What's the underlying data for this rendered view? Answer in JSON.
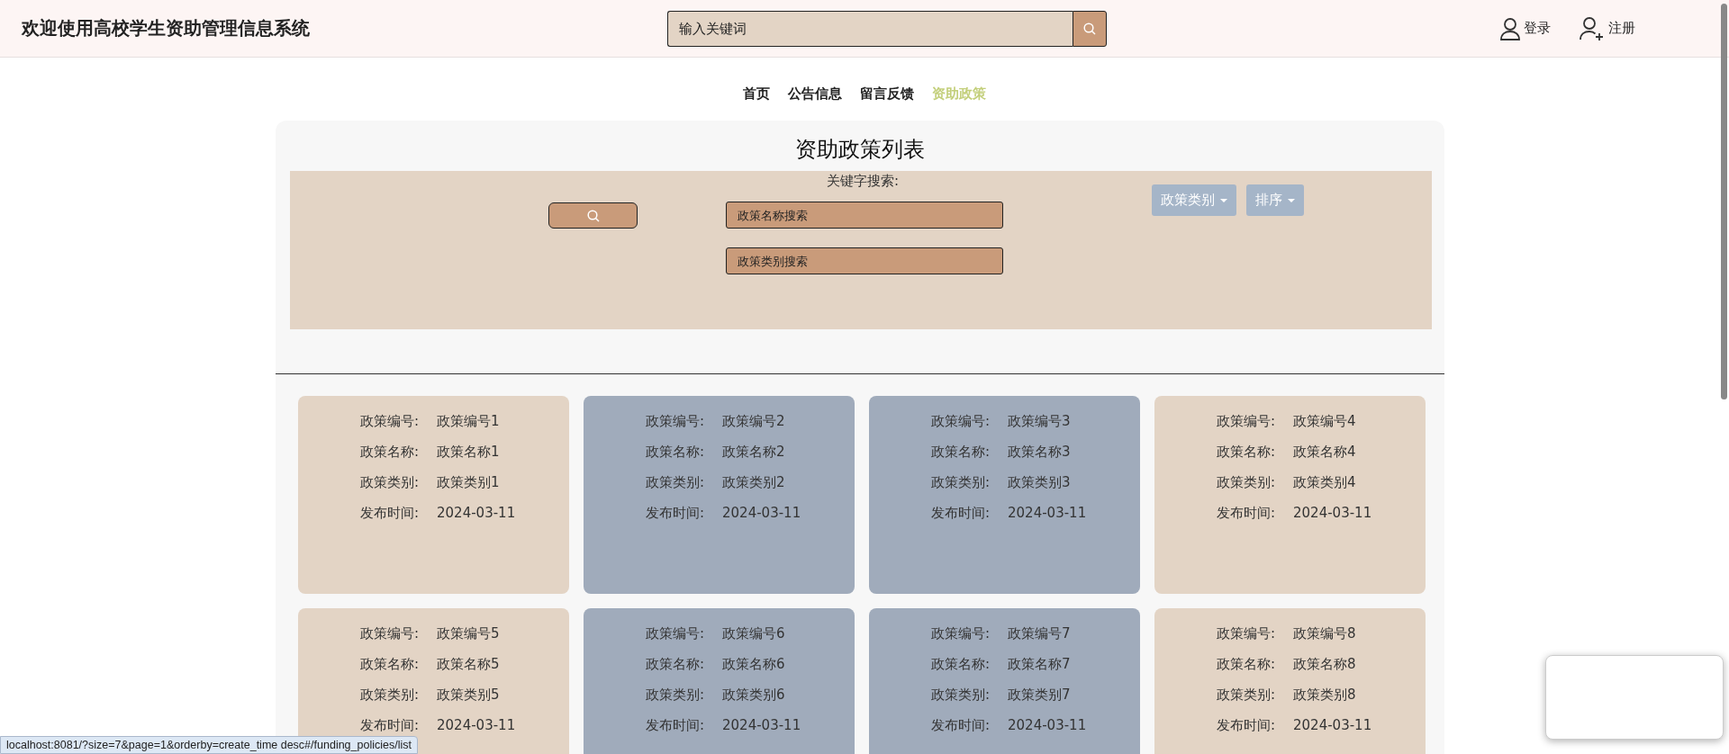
{
  "header": {
    "title": "欢迎使用高校学生资助管理信息系统",
    "search": {
      "placeholder": "输入关键词"
    },
    "links": [
      {
        "kind": "login",
        "label": "登录"
      },
      {
        "kind": "register",
        "label": "注册"
      }
    ]
  },
  "nav": [
    {
      "label": "首页",
      "selected": false
    },
    {
      "label": "公告信息",
      "selected": false
    },
    {
      "label": "留言反馈",
      "selected": false
    },
    {
      "label": "资助政策",
      "selected": true
    }
  ],
  "policy_panel": {
    "title": "资助政策列表",
    "search": {
      "label": "关键字搜索:",
      "fields": [
        {
          "placeholder": "政策名称搜索"
        },
        {
          "placeholder": "政策类别搜索"
        }
      ],
      "dropdowns": [
        {
          "label": "政策类别"
        },
        {
          "label": "排序"
        }
      ]
    },
    "cards": [
      {
        "color": "#e3d4c5",
        "fields": [
          {
            "label": "政策编号:",
            "value": "政策编号1"
          },
          {
            "label": "政策名称:",
            "value": "政策名称1"
          },
          {
            "label": "政策类别:",
            "value": "政策类别1"
          },
          {
            "label": "发布时间:",
            "value": "2024-03-11"
          }
        ]
      },
      {
        "color": "#a0abbb",
        "fields": [
          {
            "label": "政策编号:",
            "value": "政策编号2"
          },
          {
            "label": "政策名称:",
            "value": "政策名称2"
          },
          {
            "label": "政策类别:",
            "value": "政策类别2"
          },
          {
            "label": "发布时间:",
            "value": "2024-03-11"
          }
        ]
      },
      {
        "color": "#a0abbb",
        "fields": [
          {
            "label": "政策编号:",
            "value": "政策编号3"
          },
          {
            "label": "政策名称:",
            "value": "政策名称3"
          },
          {
            "label": "政策类别:",
            "value": "政策类别3"
          },
          {
            "label": "发布时间:",
            "value": "2024-03-11"
          }
        ]
      },
      {
        "color": "#e3d4c5",
        "fields": [
          {
            "label": "政策编号:",
            "value": "政策编号4"
          },
          {
            "label": "政策名称:",
            "value": "政策名称4"
          },
          {
            "label": "政策类别:",
            "value": "政策类别4"
          },
          {
            "label": "发布时间:",
            "value": "2024-03-11"
          }
        ]
      },
      {
        "color": "#e3d4c5",
        "fields": [
          {
            "label": "政策编号:",
            "value": "政策编号5"
          },
          {
            "label": "政策名称:",
            "value": "政策名称5"
          },
          {
            "label": "政策类别:",
            "value": "政策类别5"
          },
          {
            "label": "发布时间:",
            "value": "2024-03-11"
          }
        ]
      },
      {
        "color": "#a0abbb",
        "fields": [
          {
            "label": "政策编号:",
            "value": "政策编号6"
          },
          {
            "label": "政策名称:",
            "value": "政策名称6"
          },
          {
            "label": "政策类别:",
            "value": "政策类别6"
          },
          {
            "label": "发布时间:",
            "value": "2024-03-11"
          }
        ]
      },
      {
        "color": "#a0abbb",
        "fields": [
          {
            "label": "政策编号:",
            "value": "政策编号7"
          },
          {
            "label": "政策名称:",
            "value": "政策名称7"
          },
          {
            "label": "政策类别:",
            "value": "政策类别7"
          },
          {
            "label": "发布时间:",
            "value": "2024-03-11"
          }
        ]
      },
      {
        "color": "#e3d4c5",
        "fields": [
          {
            "label": "政策编号:",
            "value": "政策编号8"
          },
          {
            "label": "政策名称:",
            "value": "政策名称8"
          },
          {
            "label": "政策类别:",
            "value": "政策类别8"
          },
          {
            "label": "发布时间:",
            "value": "2024-03-11"
          }
        ]
      }
    ]
  },
  "status_url": "localhost:8081/?size=7&page=1&orderby=create_time desc#/funding_policies/list"
}
